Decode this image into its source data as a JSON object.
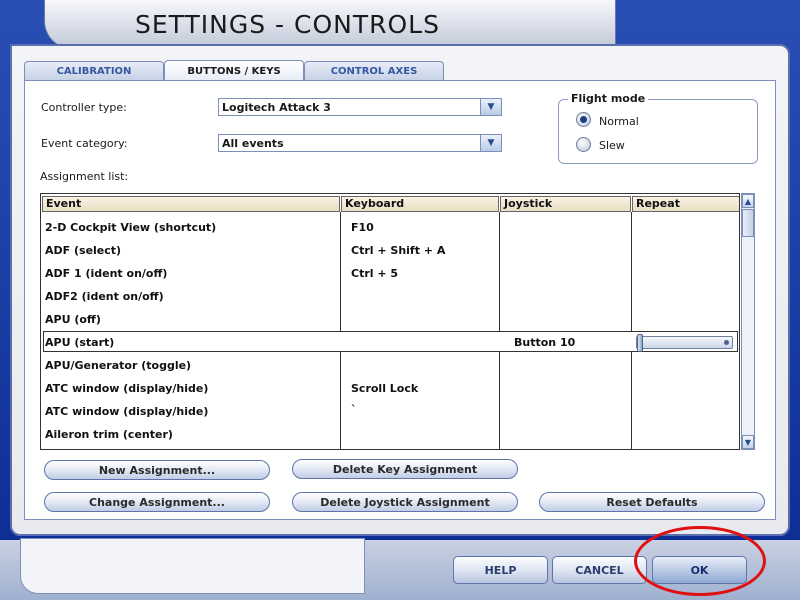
{
  "window": {
    "title": "SETTINGS - CONTROLS"
  },
  "tabs": [
    {
      "label": "CALIBRATION",
      "active": false
    },
    {
      "label": "BUTTONS / KEYS",
      "active": true
    },
    {
      "label": "CONTROL AXES",
      "active": false
    }
  ],
  "controller_type": {
    "label": "Controller type:",
    "value": "Logitech Attack 3"
  },
  "event_category": {
    "label": "Event category:",
    "value": "All events"
  },
  "flight_mode": {
    "title": "Flight mode",
    "options": [
      {
        "label": "Normal",
        "selected": true
      },
      {
        "label": "Slew",
        "selected": false
      }
    ]
  },
  "assignment_list": {
    "label": "Assignment list:",
    "columns": [
      "Event",
      "Keyboard",
      "Joystick",
      "Repeat"
    ],
    "rows": [
      {
        "event": "2-D Cockpit View (shortcut)",
        "keyboard": "F10",
        "joystick": ""
      },
      {
        "event": "ADF (select)",
        "keyboard": "Ctrl + Shift + A",
        "joystick": ""
      },
      {
        "event": "ADF 1 (ident on/off)",
        "keyboard": "Ctrl + 5",
        "joystick": ""
      },
      {
        "event": "ADF2 (ident on/off)",
        "keyboard": "",
        "joystick": ""
      },
      {
        "event": "APU (off)",
        "keyboard": "",
        "joystick": ""
      },
      {
        "event": "APU (start)",
        "keyboard": "",
        "joystick": "Button 10",
        "selected": true
      },
      {
        "event": "APU/Generator (toggle)",
        "keyboard": "",
        "joystick": ""
      },
      {
        "event": "ATC window (display/hide)",
        "keyboard": "Scroll Lock",
        "joystick": ""
      },
      {
        "event": "ATC window (display/hide)",
        "keyboard": "`",
        "joystick": ""
      },
      {
        "event": "Aileron trim (center)",
        "keyboard": "",
        "joystick": ""
      }
    ],
    "selected_repeat_level": 0
  },
  "actions": {
    "new_assignment": "New Assignment...",
    "delete_key_assignment": "Delete Key Assignment",
    "change_assignment": "Change Assignment...",
    "delete_joystick_assignment": "Delete Joystick Assignment",
    "reset_defaults": "Reset Defaults"
  },
  "footer": {
    "help": "HELP",
    "cancel": "CANCEL",
    "ok": "OK"
  },
  "colors": {
    "frame": "#0b2c92",
    "highlight_ring": "#e01010",
    "header": "#e9ddc3"
  },
  "icons": {
    "dropdown": "chevron-down-icon",
    "scroll_up": "arrow-up-icon",
    "scroll_down": "arrow-down-icon"
  }
}
